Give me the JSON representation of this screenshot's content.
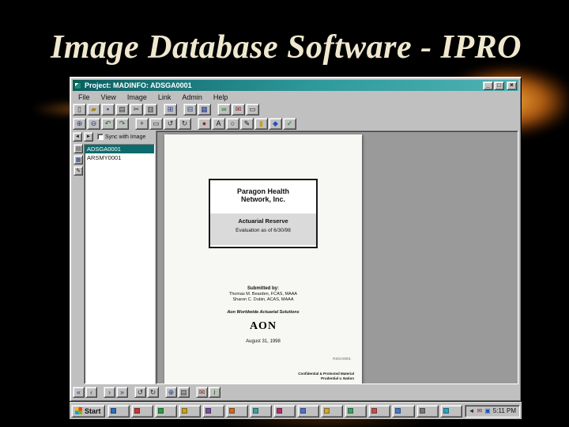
{
  "slide": {
    "title": "Image Database Software - IPRO",
    "title_color": "#efe8cf",
    "background_color": "#000000",
    "glow_color": "#db7316"
  },
  "window": {
    "title": "Project: MADINFO: ADSGA0001",
    "titlebar_colors": [
      "#0b5e60",
      "#4fb2b2"
    ],
    "controls": [
      {
        "name": "minimize-button",
        "glyph": "_"
      },
      {
        "name": "maximize-button",
        "glyph": "□"
      },
      {
        "name": "close-button",
        "glyph": "×"
      }
    ],
    "menu": [
      "File",
      "View",
      "Image",
      "Link",
      "Admin",
      "Help"
    ],
    "toolbar_main": [
      {
        "name": "new-document-icon",
        "glyph": "▯",
        "color": "#333333"
      },
      {
        "name": "open-folder-icon",
        "glyph": "▰",
        "color": "#a8821e"
      },
      {
        "name": "save-icon",
        "glyph": "▪",
        "color": "#333a8a"
      },
      {
        "name": "print-icon",
        "glyph": "▤",
        "color": "#333333"
      },
      {
        "name": "cut-icon",
        "glyph": "✂",
        "color": "#333333"
      },
      {
        "name": "copy-icon",
        "glyph": "▥",
        "color": "#333333"
      },
      {
        "name": "index-grid-icon",
        "glyph": "⊞",
        "color": "#203a8a",
        "gap": true
      },
      {
        "name": "table-view-icon",
        "glyph": "⊟",
        "color": "#203a8a",
        "gap": true
      },
      {
        "name": "image-view-icon",
        "glyph": "▦",
        "color": "#203a8a"
      },
      {
        "name": "link-icon",
        "glyph": "∞",
        "color": "#106a10",
        "gap": true
      },
      {
        "name": "mail-icon",
        "glyph": "✉",
        "color": "#8a2020"
      },
      {
        "name": "exit-icon",
        "glyph": "▭",
        "color": "#333333"
      }
    ],
    "toolbar_image": [
      {
        "name": "zoom-in-icon",
        "glyph": "⊕",
        "color": "#203a8a"
      },
      {
        "name": "zoom-out-icon",
        "glyph": "⊖",
        "color": "#203a8a"
      },
      {
        "name": "undo-icon",
        "glyph": "↶",
        "color": "#106a10"
      },
      {
        "name": "redo-icon",
        "glyph": "↷",
        "color": "#106a10"
      },
      {
        "name": "pan-icon",
        "glyph": "+",
        "color": "#333333",
        "gap": true
      },
      {
        "name": "select-region-icon",
        "glyph": "▭",
        "color": "#333333"
      },
      {
        "name": "rotate-left-icon",
        "glyph": "↺",
        "color": "#333333"
      },
      {
        "name": "rotate-right-icon",
        "glyph": "↻",
        "color": "#333333"
      },
      {
        "name": "annotate-dot-icon",
        "glyph": "●",
        "color": "#a02020",
        "gap": true
      },
      {
        "name": "text-annotation-icon",
        "glyph": "A",
        "color": "#111111"
      },
      {
        "name": "ellipse-annotation-icon",
        "glyph": "○",
        "color": "#111111"
      },
      {
        "name": "pen-annotation-icon",
        "glyph": "✎",
        "color": "#111111"
      },
      {
        "name": "highlighter-icon",
        "glyph": "▮",
        "color": "#c2a418"
      },
      {
        "name": "sticky-note-icon",
        "glyph": "◆",
        "color": "#2050c0"
      },
      {
        "name": "approve-check-icon",
        "glyph": "✓",
        "color": "#0d7a2a"
      }
    ],
    "left_tools": [
      {
        "name": "page-list-icon",
        "glyph": "▤",
        "color": "#333333"
      },
      {
        "name": "thumbnail-icon",
        "glyph": "▦",
        "color": "#203a8a"
      },
      {
        "name": "notes-icon",
        "glyph": "✎",
        "color": "#111111"
      }
    ],
    "nav": {
      "back_glyph": "◄",
      "forward_glyph": "►"
    },
    "left_panel": {
      "sync_label": "Sync with Image",
      "sync_checked": false,
      "selected_color": "#0e6b6d",
      "items": [
        {
          "label": "ADSGA0001",
          "selected": true
        },
        {
          "label": "ARSMY0001",
          "selected": false
        }
      ]
    },
    "document": {
      "box_title_line1": "Paragon Health",
      "box_title_line2": "Network, Inc.",
      "box_subtitle_line1": "Actuarial Reserve",
      "box_subtitle_line2": "Evaluation as of 6/30/98",
      "submitted_label": "Submitted by:",
      "authors": [
        "Thomas M. Bearden, FCAS, MAAA",
        "Sharon C. Dubin, ACAS, MAAA"
      ],
      "organization": "Aon Worldwide Actuarial Solutions",
      "logo_text": "AON",
      "date": "August 31, 1998",
      "doc_id": "RSGA0001",
      "footer_line1": "Confidential & Protected Material",
      "footer_line2": "Prudential v. Nation"
    },
    "bottom_toolbar": [
      {
        "name": "first-page-icon",
        "glyph": "«",
        "color": "#203a8a"
      },
      {
        "name": "prev-page-icon",
        "glyph": "‹",
        "color": "#203a8a"
      },
      {
        "name": "next-page-icon",
        "glyph": "›",
        "color": "#203a8a",
        "gap": true
      },
      {
        "name": "last-page-icon",
        "glyph": "»",
        "color": "#203a8a"
      },
      {
        "name": "rotate-page-left-icon",
        "glyph": "↺",
        "color": "#333333",
        "gap": true
      },
      {
        "name": "rotate-page-right-icon",
        "glyph": "↻",
        "color": "#333333"
      },
      {
        "name": "zoom-page-icon",
        "glyph": "⊕",
        "color": "#203a8a",
        "gap": true
      },
      {
        "name": "print-page-icon",
        "glyph": "▤",
        "color": "#333333"
      },
      {
        "name": "mail-page-icon",
        "glyph": "✉",
        "color": "#8a2020",
        "gap": true
      },
      {
        "name": "page-info-icon",
        "glyph": "i",
        "color": "#106a10"
      }
    ]
  },
  "taskbar": {
    "start_label": "Start",
    "buttons": [
      {
        "color": "#2a6fbd"
      },
      {
        "color": "#c23a32"
      },
      {
        "color": "#2a9a46"
      },
      {
        "color": "#c8a022"
      },
      {
        "color": "#7a4fa0"
      },
      {
        "color": "#c86a28"
      },
      {
        "color": "#3aa0a0"
      },
      {
        "color": "#b03070"
      },
      {
        "color": "#5070d0"
      },
      {
        "color": "#caa838"
      },
      {
        "color": "#40a060"
      },
      {
        "color": "#c05050"
      },
      {
        "color": "#4878c8"
      },
      {
        "color": "#777777"
      },
      {
        "color": "#30a0c0"
      }
    ],
    "tray_icons": [
      {
        "name": "speaker-icon",
        "glyph": "◄",
        "color": "#333333"
      },
      {
        "name": "mail-status-icon",
        "glyph": "✉",
        "color": "#a02020"
      },
      {
        "name": "display-settings-icon",
        "glyph": "▣",
        "color": "#2050c0"
      }
    ],
    "time": "5:11 PM"
  }
}
